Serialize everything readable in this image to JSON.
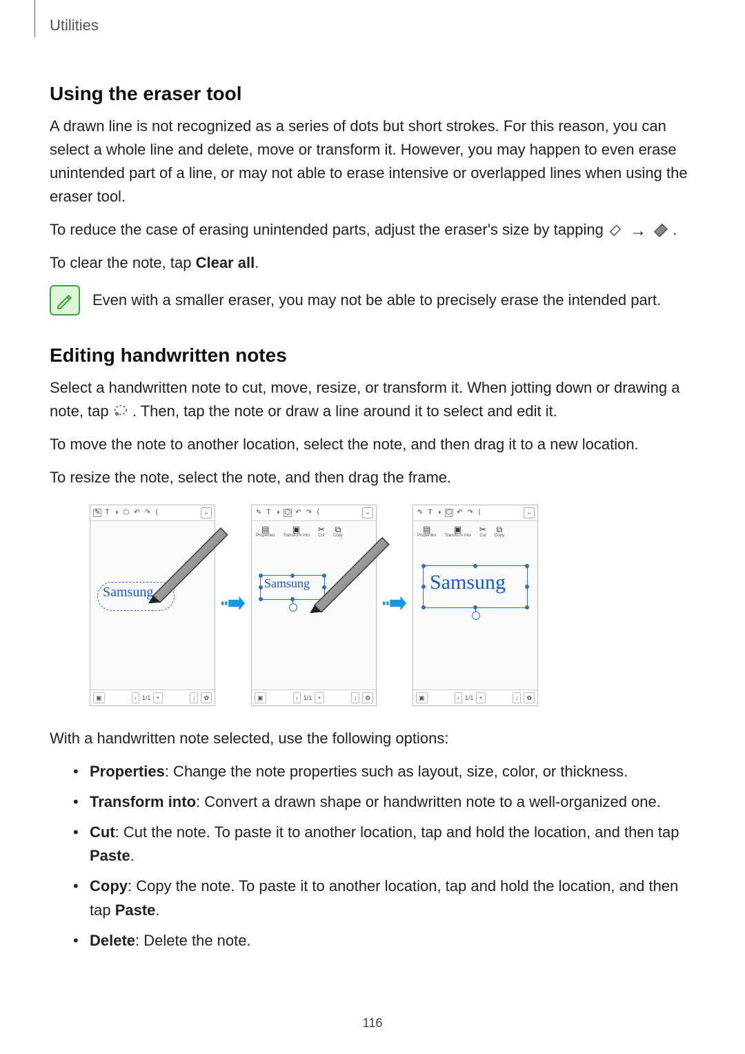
{
  "section": "Utilities",
  "page_number": "116",
  "h1": "Using the eraser tool",
  "p1": "A drawn line is not recognized as a series of dots but short strokes. For this reason, you can select a whole line and delete, move or transform it. However, you may happen to even erase unintended part of a line, or may not able to erase intensive or overlapped lines when using the eraser tool.",
  "p2a": "To reduce the case of erasing unintended parts, adjust the eraser's size by tapping ",
  "p2b": ".",
  "p3a": "To clear the note, tap ",
  "p3_bold": "Clear all",
  "p3b": ".",
  "note1": "Even with a smaller eraser, you may not be able to precisely erase the intended part.",
  "h2": "Editing handwritten notes",
  "p4a": "Select a handwritten note to cut, move, resize, or transform it. When jotting down or drawing a note, tap ",
  "p4b": ". Then, tap the note or draw a line around it to select and edit it.",
  "p5": "To move the note to another location, select the note, and then drag it to a new location.",
  "p6": "To resize the note, select the note, and then drag the frame.",
  "shots": {
    "toolbar_glyphs": [
      "✎",
      "T",
      "◑",
      "⬡",
      "↶",
      "↷",
      "⟨"
    ],
    "toolbar_collapse": "⌄",
    "pagecounter": "1/1",
    "bottom_glyphs_left": [
      "▣"
    ],
    "bottom_glyphs_right": [
      "↓",
      "✿"
    ],
    "handwriting": "Samsung",
    "edit_items": [
      {
        "icon": "▤",
        "label": "Properties"
      },
      {
        "icon": "▣",
        "label": "Transform into"
      },
      {
        "icon": "✂",
        "label": "Cut"
      },
      {
        "icon": "⧉",
        "label": "Copy"
      }
    ]
  },
  "options_intro": "With a handwritten note selected, use the following options:",
  "options": [
    {
      "term": "Properties",
      "desc": ": Change the note properties such as layout, size, color, or thickness."
    },
    {
      "term": "Transform into",
      "desc": ": Convert a drawn shape or handwritten note to a well-organized one."
    },
    {
      "term": "Cut",
      "desc_a": ": Cut the note. To paste it to another location, tap and hold the location, and then tap ",
      "paste": "Paste",
      "desc_b": "."
    },
    {
      "term": "Copy",
      "desc_a": ": Copy the note. To paste it to another location, tap and hold the location, and then tap ",
      "paste": "Paste",
      "desc_b": "."
    },
    {
      "term": "Delete",
      "desc": ": Delete the note."
    }
  ]
}
